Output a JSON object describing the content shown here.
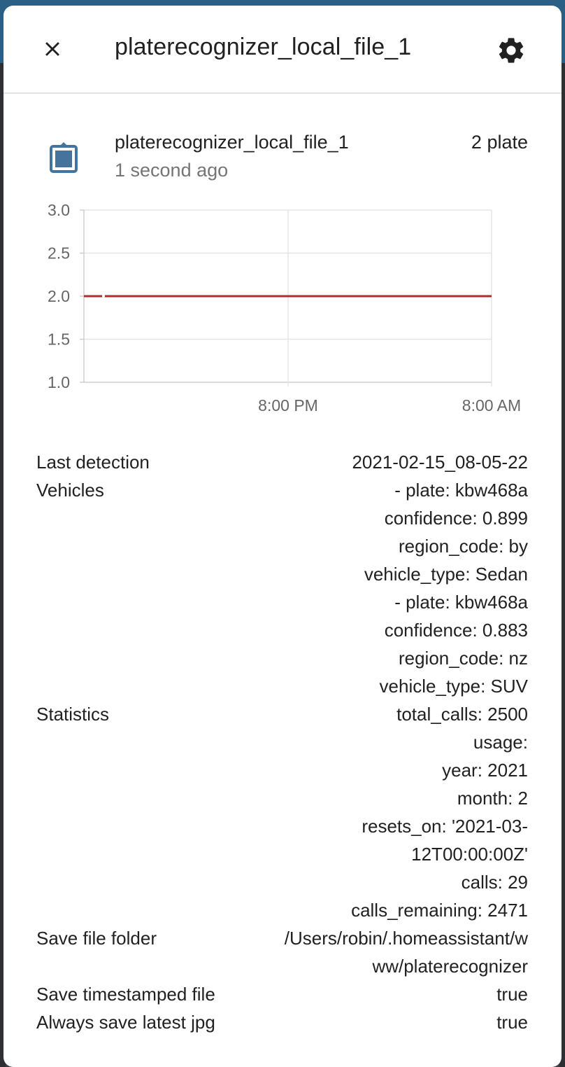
{
  "header": {
    "title": "platerecognizer_local_file_1"
  },
  "entity": {
    "name": "platerecognizer_local_file_1",
    "last_changed": "1 second ago",
    "state": "2 plate",
    "icon": "clipboard-icon",
    "icon_color": "#44739e"
  },
  "chart_data": {
    "type": "line",
    "yticks": [
      "3.0",
      "2.5",
      "2.0",
      "1.5",
      "1.0"
    ],
    "xticks": [
      "8:00 PM",
      "8:00 AM"
    ],
    "ylim": [
      1.0,
      3.0
    ],
    "series": [
      {
        "color": "#a83228",
        "values": [
          2,
          2
        ]
      }
    ],
    "grid": true
  },
  "attributes": [
    {
      "key": "Last detection",
      "lines": [
        "2021-02-15_08-05-22"
      ]
    },
    {
      "key": "Vehicles",
      "lines": [
        "- plate: kbw468a",
        "confidence: 0.899",
        "region_code: by",
        "vehicle_type: Sedan",
        "- plate: kbw468a",
        "confidence: 0.883",
        "region_code: nz",
        "vehicle_type: SUV"
      ]
    },
    {
      "key": "Statistics",
      "lines": [
        "total_calls: 2500",
        "usage:",
        "year: 2021",
        "month: 2",
        "resets_on: '2021-03-",
        "12T00:00:00Z'",
        "calls: 29",
        "calls_remaining: 2471"
      ]
    },
    {
      "key": "Save file folder",
      "lines": [
        "/Users/robin/.homeassistant/w",
        "ww/platerecognizer"
      ]
    },
    {
      "key": "Save timestamped file",
      "lines": [
        "true"
      ]
    },
    {
      "key": "Always save latest jpg",
      "lines": [
        "true"
      ]
    }
  ]
}
